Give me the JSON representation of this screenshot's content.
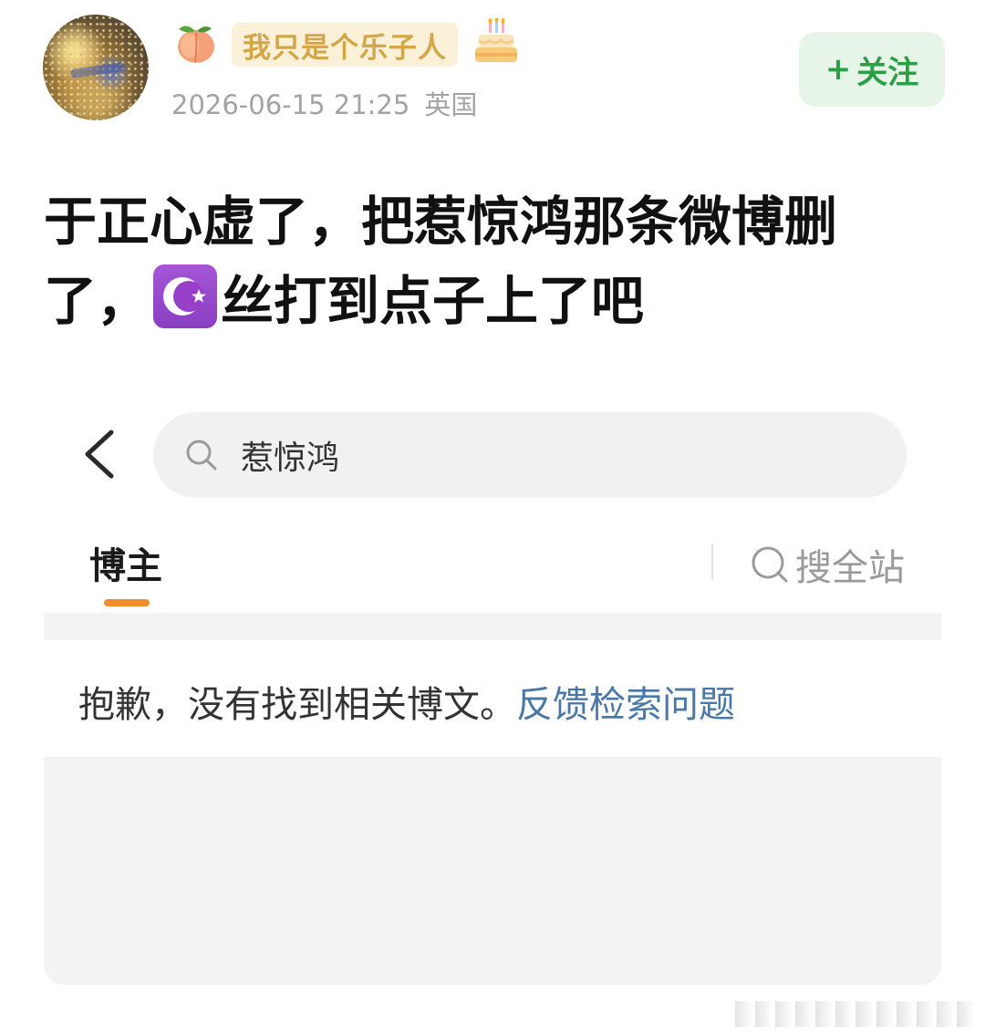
{
  "post": {
    "author": {
      "name": "我只是个乐子人",
      "avatar_icon": "avatar-image",
      "badge_icon": "peach-emoji-icon",
      "trailing_icon": "birthday-cake-icon"
    },
    "meta": {
      "timestamp": "2026-06-15 21:25",
      "location": "英国"
    },
    "follow": {
      "plus": "+",
      "label": "关注"
    },
    "text": {
      "line1": "于正心虚了，把惹惊鸿那条微博删",
      "line2_before": "了，",
      "emoji": "star-and-crescent-emoji-icon",
      "line2_after": "丝打到点子上了吧"
    }
  },
  "screenshot": {
    "back_icon": "chevron-left-icon",
    "search": {
      "query": "惹惊鸿",
      "icon": "search-icon"
    },
    "tabs": {
      "active": "博主",
      "search_all": "搜全站"
    },
    "empty_state": {
      "message": "抱歉，没有找到相关博文。",
      "link": "反馈检索问题"
    }
  },
  "colors": {
    "follow_bg": "#e6f5e8",
    "follow_text": "#2c9e46",
    "nick_text": "#d3a647",
    "tab_indicator": "#f28c28",
    "link": "#4a78a6"
  }
}
